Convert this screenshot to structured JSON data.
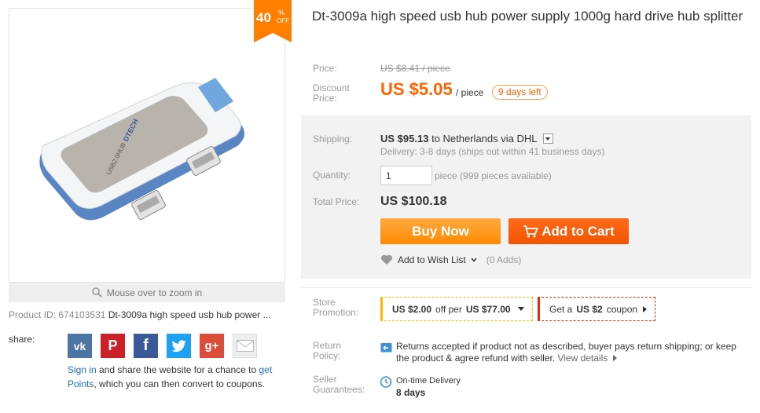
{
  "badge": {
    "percent": "40",
    "pct_sign": "%",
    "off": "OFF"
  },
  "gallery": {
    "zoom_hint": "Mouse over to zoom in"
  },
  "product": {
    "id_label": "Product ID: 674103531",
    "short_name": "Dt-3009a high speed usb hub power ...",
    "title": "Dt-3009a high speed usb hub power supply 1000g hard drive hub splitter",
    "image_brand": "DTECH",
    "image_model": "USB2.0HUB"
  },
  "share": {
    "label": "share:",
    "icons": [
      "vk-icon",
      "pinterest-icon",
      "facebook-icon",
      "twitter-icon",
      "google-plus-icon",
      "email-icon"
    ],
    "vk": "vk",
    "pinterest": "P",
    "facebook": "f",
    "google": "g+",
    "signin_link": "Sign in",
    "signin_text": " and share the website for a chance to ",
    "get_points_link_a": "get",
    "get_points_link_b": "Points",
    "signin_tail": ", which you can then convert to coupons."
  },
  "pricing": {
    "price_label": "Price:",
    "original_price": "US $8.41 / piece",
    "discount_label_1": "Discount",
    "discount_label_2": "Price:",
    "discount_price": "US $5.05",
    "per_piece": "/ piece",
    "days_left": "9 days left"
  },
  "shipping": {
    "label": "Shipping:",
    "cost": "US $95.13",
    "to": "to",
    "destination": "Netherlands via DHL",
    "delivery": "Delivery: 3-8 days (ships out within 41 business days)"
  },
  "quantity": {
    "label": "Quantity:",
    "value": "1",
    "note": "piece (999 pieces available)"
  },
  "total": {
    "label": "Total Price:",
    "value": "US $100.18"
  },
  "actions": {
    "buy_now": "Buy Now",
    "add_to_cart": "Add to Cart",
    "wish_list": "Add to Wish List",
    "wish_count": "(0 Adds)"
  },
  "store_promotion": {
    "label_1": "Store",
    "label_2": "Promotion:",
    "promo_amount": "US $2.00",
    "promo_mid": "off per",
    "promo_min": "US $77.00",
    "coupon_pre": "Get a",
    "coupon_amount": "US $2",
    "coupon_post": "coupon"
  },
  "return_policy": {
    "label_1": "Return",
    "label_2": "Policy:",
    "text": "Returns accepted if product not as described, buyer pays return shipping; or keep the product & agree refund with seller. ",
    "details": "View details"
  },
  "seller_guarantees": {
    "label_1": "Seller",
    "label_2": "Guarantees:",
    "ontime": "On-time Delivery",
    "days": "8 days"
  },
  "colors": {
    "accent_orange": "#ff6200",
    "buy_now": "#ff8a00",
    "add_to_cart": "#f25500",
    "link_blue": "#1e6cbb",
    "promo_yellow": "#ffb800",
    "coupon_red": "#e62e04"
  }
}
